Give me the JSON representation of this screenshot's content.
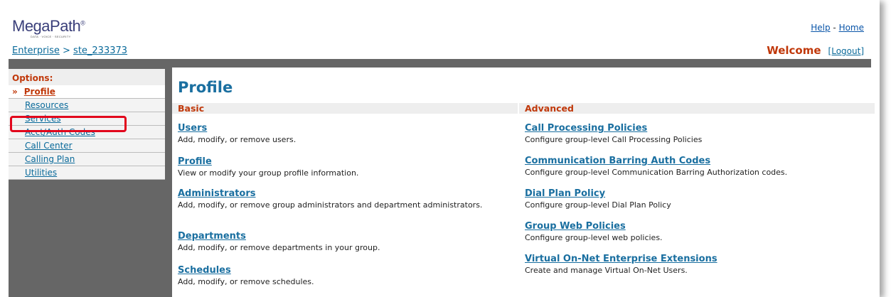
{
  "header": {
    "logo_text": "MegaPath",
    "logo_reg": "®",
    "logo_tagline": "DATA · VOICE · SECURITY",
    "help": "Help",
    "separator": " - ",
    "home": "Home",
    "breadcrumb_root": "Enterprise",
    "breadcrumb_sep": " > ",
    "breadcrumb_site": "ste_233373",
    "welcome": "Welcome",
    "logout": "[Logout]"
  },
  "sidebar": {
    "heading": "Options:",
    "active_marker": "»",
    "items": [
      {
        "label": "Profile"
      },
      {
        "label": "Resources"
      },
      {
        "label": "Services"
      },
      {
        "label": "Acct/Auth Codes"
      },
      {
        "label": "Call Center"
      },
      {
        "label": "Calling Plan"
      },
      {
        "label": "Utilities"
      }
    ]
  },
  "main": {
    "title": "Profile",
    "basic": {
      "heading": "Basic",
      "items": [
        {
          "label": "Users",
          "desc": "Add, modify, or remove users."
        },
        {
          "label": "Profile",
          "desc": "View or modify your group profile information."
        },
        {
          "label": "Administrators",
          "desc": "Add, modify, or remove group administrators and department administrators."
        },
        {
          "label": "Departments",
          "desc": "Add, modify, or remove departments in your group."
        },
        {
          "label": "Schedules",
          "desc": "Add, modify, or remove schedules."
        }
      ]
    },
    "advanced": {
      "heading": "Advanced",
      "items": [
        {
          "label": "Call Processing Policies",
          "desc": "Configure group-level Call Processing Policies"
        },
        {
          "label": "Communication Barring Auth Codes",
          "desc": "Configure group-level Communication Barring Authorization codes."
        },
        {
          "label": "Dial Plan Policy",
          "desc": "Configure group-level Dial Plan Policy"
        },
        {
          "label": "Group Web Policies",
          "desc": "Configure group-level web policies."
        },
        {
          "label": "Virtual On-Net Enterprise Extensions",
          "desc": "Create and manage Virtual On-Net Users."
        }
      ]
    }
  },
  "colors": {
    "accent_orange": "#c0380a",
    "link_blue": "#1a6fa0",
    "bar_gray": "#666666",
    "highlight_red": "#e2061c"
  }
}
